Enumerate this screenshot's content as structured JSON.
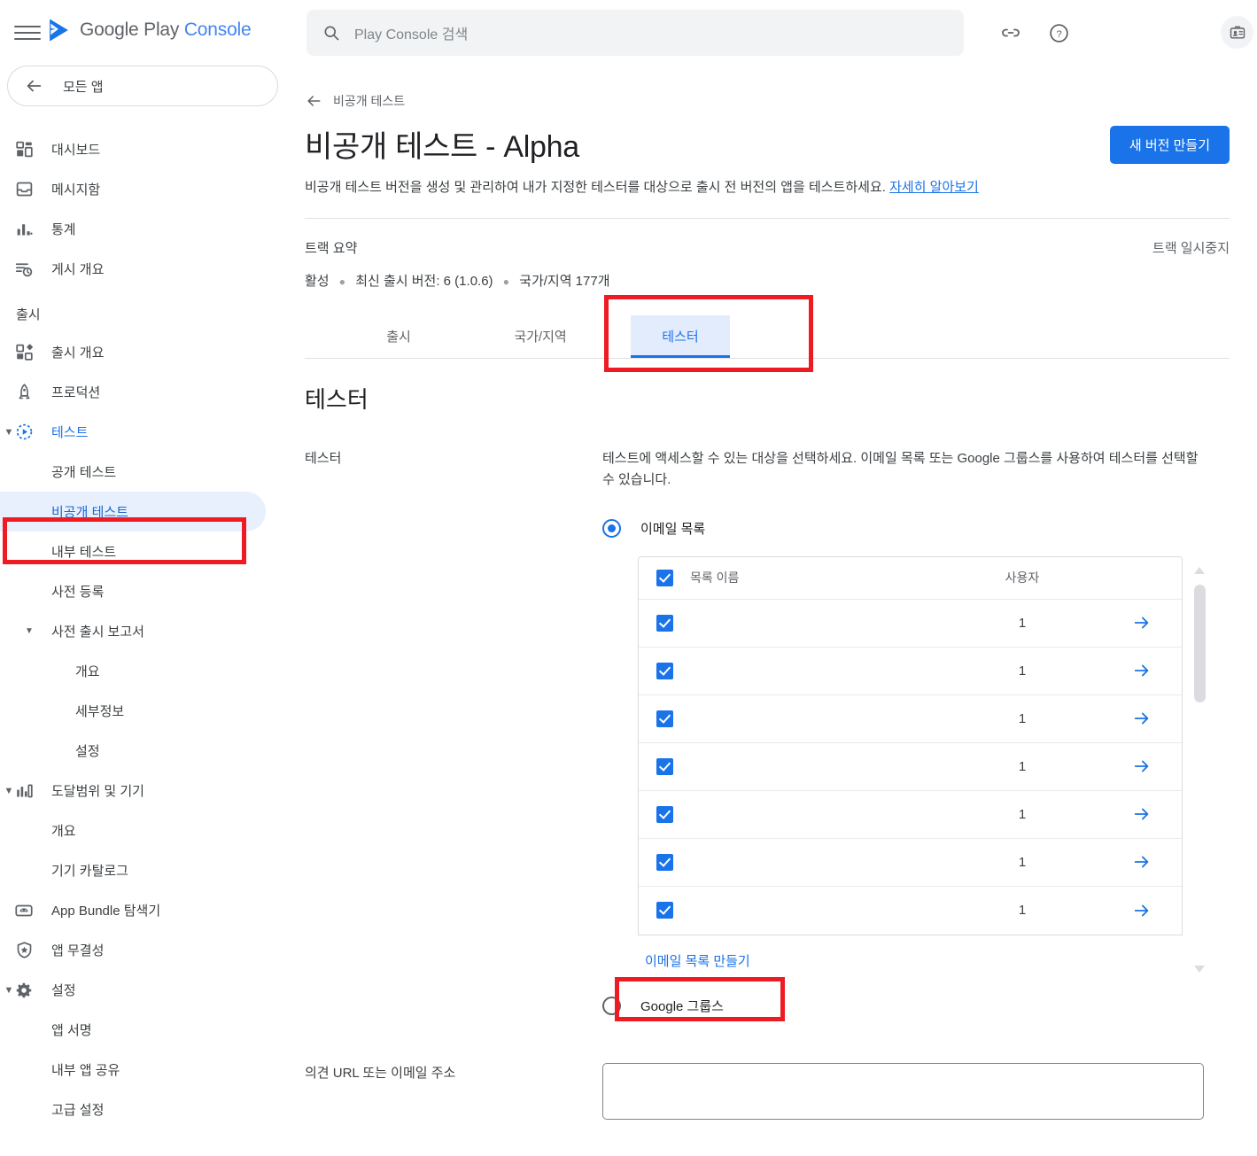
{
  "topbar": {
    "brand_google": "Google Play",
    "brand_console": "Console",
    "menu_icon": "hamburger-icon",
    "search_placeholder": "Play Console 검색",
    "search_value": "",
    "link_icon": "link-icon",
    "help_icon": "help-circle-icon",
    "account_icon": "id-badge-icon"
  },
  "sidebar": {
    "all_apps": "모든 앱",
    "top_items": [
      {
        "label": "대시보드",
        "icon": "dashboard-icon"
      },
      {
        "label": "메시지함",
        "icon": "inbox-icon"
      },
      {
        "label": "통계",
        "icon": "bar-chart-icon"
      },
      {
        "label": "게시 개요",
        "icon": "publishing-clock-icon"
      }
    ],
    "section_release": "출시",
    "release_items": [
      {
        "label": "출시 개요",
        "icon": "release-overview-icon"
      },
      {
        "label": "프로덕션",
        "icon": "rocket-icon"
      },
      {
        "label": "테스트",
        "icon": "test-play-icon"
      }
    ],
    "test_children": [
      {
        "label": "공개 테스트"
      },
      {
        "label": "비공개 테스트"
      },
      {
        "label": "내부 테스트"
      },
      {
        "label": "사전 등록"
      }
    ],
    "prerelease_report": "사전 출시 보고서",
    "prerelease_children": [
      {
        "label": "개요"
      },
      {
        "label": "세부정보"
      },
      {
        "label": "설정"
      }
    ],
    "reach_devices": "도달범위 및 기기",
    "reach_children": [
      {
        "label": "개요"
      },
      {
        "label": "기기 카탈로그"
      }
    ],
    "bottom_items": [
      {
        "label": "App Bundle 탐색기",
        "icon": "android-bundle-icon"
      },
      {
        "label": "앱 무결성",
        "icon": "shield-star-icon"
      },
      {
        "label": "설정",
        "icon": "gear-icon"
      }
    ],
    "settings_children": [
      {
        "label": "앱 서명"
      },
      {
        "label": "내부 앱 공유"
      },
      {
        "label": "고급 설정"
      }
    ]
  },
  "main": {
    "back_label": "비공개 테스트",
    "title": "비공개 테스트 - Alpha",
    "subtitle": "비공개 테스트 버전을 생성 및 관리하여 내가 지정한 테스터를 대상으로 출시 전 버전의 앱을 테스트하세요.",
    "subtitle_link": "자세히 알아보기",
    "create_version_button": "새 버전 만들기",
    "track_summary_title": "트랙 요약",
    "track_pause": "트랙 일시중지",
    "track_status": "활성",
    "track_latest_version": "최신 출시 버전: 6 (1.0.6)",
    "track_countries": "국가/지역 177개",
    "tabs": [
      {
        "label": "출시",
        "selected": false
      },
      {
        "label": "국가/지역",
        "selected": false
      },
      {
        "label": "테스터",
        "selected": true
      }
    ],
    "section_title": "테스터",
    "field_label": "테스터",
    "field_description": "테스트에 액세스할 수 있는 대상을 선택하세요. 이메일 목록 또는 Google 그룹스를 사용하여 테스터를 선택할 수 있습니다.",
    "radio_email_list": "이메일 목록",
    "radio_google_groups": "Google 그룹스",
    "table": {
      "header": {
        "name": "목록 이름",
        "users": "사용자"
      },
      "rows": [
        {
          "name": "",
          "users": "1"
        },
        {
          "name": "",
          "users": "1"
        },
        {
          "name": "",
          "users": "1"
        },
        {
          "name": "",
          "users": "1"
        },
        {
          "name": "",
          "users": "1"
        },
        {
          "name": "",
          "users": "1"
        },
        {
          "name": "",
          "users": "1"
        }
      ]
    },
    "create_email_list_link": "이메일 목록 만들기",
    "feedback_label": "의견 URL 또는 이메일 주소",
    "feedback_value": "",
    "feedback_placeholder": ""
  },
  "colors": {
    "accent_blue": "#1a73e8",
    "annotation_red": "#ef1b23",
    "selected_nav_bg": "#e8f0fe"
  }
}
